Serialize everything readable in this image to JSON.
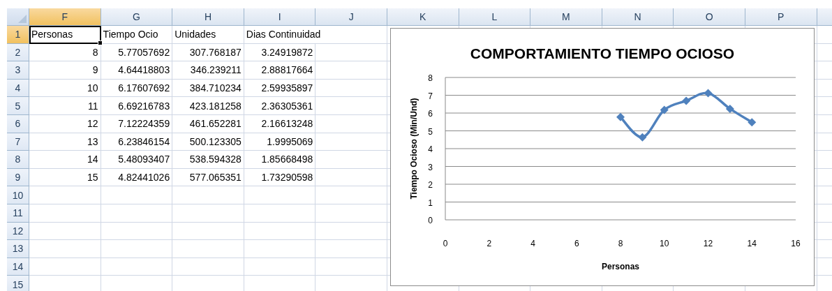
{
  "columns": [
    {
      "label": "F",
      "selected": true
    },
    {
      "label": "G",
      "selected": false
    },
    {
      "label": "H",
      "selected": false
    },
    {
      "label": "I",
      "selected": false
    },
    {
      "label": "J",
      "selected": false
    },
    {
      "label": "K",
      "selected": false
    },
    {
      "label": "L",
      "selected": false
    },
    {
      "label": "M",
      "selected": false
    },
    {
      "label": "N",
      "selected": false
    },
    {
      "label": "O",
      "selected": false
    },
    {
      "label": "P",
      "selected": false
    }
  ],
  "rows": [
    {
      "number": "1",
      "selected": true,
      "cells": [
        {
          "text": "Personas",
          "kind": "text",
          "selected": true
        },
        {
          "text": "Tiempo Ocio",
          "kind": "text",
          "selected": false
        },
        {
          "text": "Unidades",
          "kind": "text",
          "selected": false
        },
        {
          "text": "Dias Continuidad",
          "kind": "text",
          "selected": false
        }
      ]
    },
    {
      "number": "2",
      "selected": false,
      "cells": [
        {
          "text": "8",
          "kind": "number",
          "selected": false
        },
        {
          "text": "5.77057692",
          "kind": "number",
          "selected": false
        },
        {
          "text": "307.768187",
          "kind": "number",
          "selected": false
        },
        {
          "text": "3.24919872",
          "kind": "number",
          "selected": false
        }
      ]
    },
    {
      "number": "3",
      "selected": false,
      "cells": [
        {
          "text": "9",
          "kind": "number",
          "selected": false
        },
        {
          "text": "4.64418803",
          "kind": "number",
          "selected": false
        },
        {
          "text": "346.239211",
          "kind": "number",
          "selected": false
        },
        {
          "text": "2.88817664",
          "kind": "number",
          "selected": false
        }
      ]
    },
    {
      "number": "4",
      "selected": false,
      "cells": [
        {
          "text": "10",
          "kind": "number",
          "selected": false
        },
        {
          "text": "6.17607692",
          "kind": "number",
          "selected": false
        },
        {
          "text": "384.710234",
          "kind": "number",
          "selected": false
        },
        {
          "text": "2.59935897",
          "kind": "number",
          "selected": false
        }
      ]
    },
    {
      "number": "5",
      "selected": false,
      "cells": [
        {
          "text": "11",
          "kind": "number",
          "selected": false
        },
        {
          "text": "6.69216783",
          "kind": "number",
          "selected": false
        },
        {
          "text": "423.181258",
          "kind": "number",
          "selected": false
        },
        {
          "text": "2.36305361",
          "kind": "number",
          "selected": false
        }
      ]
    },
    {
      "number": "6",
      "selected": false,
      "cells": [
        {
          "text": "12",
          "kind": "number",
          "selected": false
        },
        {
          "text": "7.12224359",
          "kind": "number",
          "selected": false
        },
        {
          "text": "461.652281",
          "kind": "number",
          "selected": false
        },
        {
          "text": "2.16613248",
          "kind": "number",
          "selected": false
        }
      ]
    },
    {
      "number": "7",
      "selected": false,
      "cells": [
        {
          "text": "13",
          "kind": "number",
          "selected": false
        },
        {
          "text": "6.23846154",
          "kind": "number",
          "selected": false
        },
        {
          "text": "500.123305",
          "kind": "number",
          "selected": false
        },
        {
          "text": "1.9995069",
          "kind": "number",
          "selected": false
        }
      ]
    },
    {
      "number": "8",
      "selected": false,
      "cells": [
        {
          "text": "14",
          "kind": "number",
          "selected": false
        },
        {
          "text": "5.48093407",
          "kind": "number",
          "selected": false
        },
        {
          "text": "538.594328",
          "kind": "number",
          "selected": false
        },
        {
          "text": "1.85668498",
          "kind": "number",
          "selected": false
        }
      ]
    },
    {
      "number": "9",
      "selected": false,
      "cells": [
        {
          "text": "15",
          "kind": "number",
          "selected": false
        },
        {
          "text": "4.82441026",
          "kind": "number",
          "selected": false
        },
        {
          "text": "577.065351",
          "kind": "number",
          "selected": false
        },
        {
          "text": "1.73290598",
          "kind": "number",
          "selected": false
        }
      ]
    },
    {
      "number": "10",
      "selected": false
    },
    {
      "number": "11",
      "selected": false
    },
    {
      "number": "12",
      "selected": false
    },
    {
      "number": "13",
      "selected": false
    },
    {
      "number": "14",
      "selected": false
    },
    {
      "number": "15",
      "selected": false
    }
  ],
  "chart": {
    "chart_data": {
      "type": "line",
      "grid": true,
      "title": "COMPORTAMIENTO TIEMPO OCIOSO",
      "xlabel": "Personas",
      "ylabel": "Tiempo Ocioso  (Min/Und)",
      "x": [
        8,
        9,
        10,
        11,
        12,
        13,
        14
      ],
      "series": [
        {
          "color": "#4f81bd",
          "marker": "diamond",
          "values": [
            5.77,
            4.64,
            6.18,
            6.69,
            7.12,
            6.24,
            5.48
          ]
        }
      ],
      "xlim": [
        0,
        16
      ],
      "ylim": [
        0,
        8
      ],
      "xticks": [
        0,
        2,
        4,
        6,
        8,
        10,
        12,
        14,
        16
      ],
      "yticks": [
        0,
        1,
        2,
        3,
        4,
        5,
        6,
        7,
        8
      ]
    }
  }
}
